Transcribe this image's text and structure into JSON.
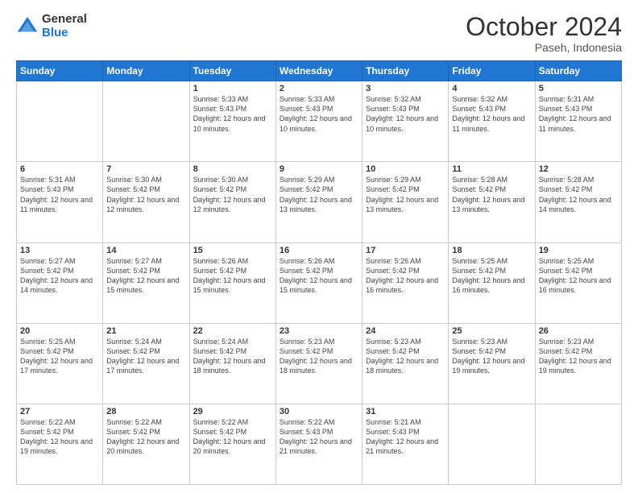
{
  "header": {
    "logo_general": "General",
    "logo_blue": "Blue",
    "month_title": "October 2024",
    "location": "Paseh, Indonesia"
  },
  "days_of_week": [
    "Sunday",
    "Monday",
    "Tuesday",
    "Wednesday",
    "Thursday",
    "Friday",
    "Saturday"
  ],
  "weeks": [
    [
      {
        "day": "",
        "info": ""
      },
      {
        "day": "",
        "info": ""
      },
      {
        "day": "1",
        "info": "Sunrise: 5:33 AM\nSunset: 5:43 PM\nDaylight: 12 hours and 10 minutes."
      },
      {
        "day": "2",
        "info": "Sunrise: 5:33 AM\nSunset: 5:43 PM\nDaylight: 12 hours and 10 minutes."
      },
      {
        "day": "3",
        "info": "Sunrise: 5:32 AM\nSunset: 5:43 PM\nDaylight: 12 hours and 10 minutes."
      },
      {
        "day": "4",
        "info": "Sunrise: 5:32 AM\nSunset: 5:43 PM\nDaylight: 12 hours and 11 minutes."
      },
      {
        "day": "5",
        "info": "Sunrise: 5:31 AM\nSunset: 5:43 PM\nDaylight: 12 hours and 11 minutes."
      }
    ],
    [
      {
        "day": "6",
        "info": "Sunrise: 5:31 AM\nSunset: 5:43 PM\nDaylight: 12 hours and 11 minutes."
      },
      {
        "day": "7",
        "info": "Sunrise: 5:30 AM\nSunset: 5:42 PM\nDaylight: 12 hours and 12 minutes."
      },
      {
        "day": "8",
        "info": "Sunrise: 5:30 AM\nSunset: 5:42 PM\nDaylight: 12 hours and 12 minutes."
      },
      {
        "day": "9",
        "info": "Sunrise: 5:29 AM\nSunset: 5:42 PM\nDaylight: 12 hours and 13 minutes."
      },
      {
        "day": "10",
        "info": "Sunrise: 5:29 AM\nSunset: 5:42 PM\nDaylight: 12 hours and 13 minutes."
      },
      {
        "day": "11",
        "info": "Sunrise: 5:28 AM\nSunset: 5:42 PM\nDaylight: 12 hours and 13 minutes."
      },
      {
        "day": "12",
        "info": "Sunrise: 5:28 AM\nSunset: 5:42 PM\nDaylight: 12 hours and 14 minutes."
      }
    ],
    [
      {
        "day": "13",
        "info": "Sunrise: 5:27 AM\nSunset: 5:42 PM\nDaylight: 12 hours and 14 minutes."
      },
      {
        "day": "14",
        "info": "Sunrise: 5:27 AM\nSunset: 5:42 PM\nDaylight: 12 hours and 15 minutes."
      },
      {
        "day": "15",
        "info": "Sunrise: 5:26 AM\nSunset: 5:42 PM\nDaylight: 12 hours and 15 minutes."
      },
      {
        "day": "16",
        "info": "Sunrise: 5:26 AM\nSunset: 5:42 PM\nDaylight: 12 hours and 15 minutes."
      },
      {
        "day": "17",
        "info": "Sunrise: 5:26 AM\nSunset: 5:42 PM\nDaylight: 12 hours and 16 minutes."
      },
      {
        "day": "18",
        "info": "Sunrise: 5:25 AM\nSunset: 5:42 PM\nDaylight: 12 hours and 16 minutes."
      },
      {
        "day": "19",
        "info": "Sunrise: 5:25 AM\nSunset: 5:42 PM\nDaylight: 12 hours and 16 minutes."
      }
    ],
    [
      {
        "day": "20",
        "info": "Sunrise: 5:25 AM\nSunset: 5:42 PM\nDaylight: 12 hours and 17 minutes."
      },
      {
        "day": "21",
        "info": "Sunrise: 5:24 AM\nSunset: 5:42 PM\nDaylight: 12 hours and 17 minutes."
      },
      {
        "day": "22",
        "info": "Sunrise: 5:24 AM\nSunset: 5:42 PM\nDaylight: 12 hours and 18 minutes."
      },
      {
        "day": "23",
        "info": "Sunrise: 5:23 AM\nSunset: 5:42 PM\nDaylight: 12 hours and 18 minutes."
      },
      {
        "day": "24",
        "info": "Sunrise: 5:23 AM\nSunset: 5:42 PM\nDaylight: 12 hours and 18 minutes."
      },
      {
        "day": "25",
        "info": "Sunrise: 5:23 AM\nSunset: 5:42 PM\nDaylight: 12 hours and 19 minutes."
      },
      {
        "day": "26",
        "info": "Sunrise: 5:23 AM\nSunset: 5:42 PM\nDaylight: 12 hours and 19 minutes."
      }
    ],
    [
      {
        "day": "27",
        "info": "Sunrise: 5:22 AM\nSunset: 5:42 PM\nDaylight: 12 hours and 19 minutes."
      },
      {
        "day": "28",
        "info": "Sunrise: 5:22 AM\nSunset: 5:42 PM\nDaylight: 12 hours and 20 minutes."
      },
      {
        "day": "29",
        "info": "Sunrise: 5:22 AM\nSunset: 5:42 PM\nDaylight: 12 hours and 20 minutes."
      },
      {
        "day": "30",
        "info": "Sunrise: 5:22 AM\nSunset: 5:43 PM\nDaylight: 12 hours and 21 minutes."
      },
      {
        "day": "31",
        "info": "Sunrise: 5:21 AM\nSunset: 5:43 PM\nDaylight: 12 hours and 21 minutes."
      },
      {
        "day": "",
        "info": ""
      },
      {
        "day": "",
        "info": ""
      }
    ]
  ]
}
